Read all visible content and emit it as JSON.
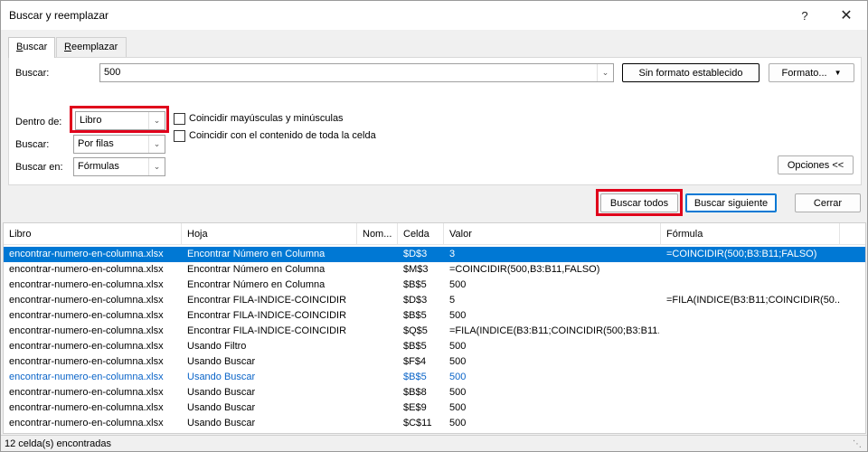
{
  "window": {
    "title": "Buscar y reemplazar",
    "help_label": "?",
    "close_label": "✕"
  },
  "tabs": {
    "find": {
      "prefix": "",
      "accel": "B",
      "rest": "uscar"
    },
    "replace": {
      "prefix": "",
      "accel": "R",
      "rest": "eemplazar"
    }
  },
  "search": {
    "label": "Buscar:",
    "value": "500",
    "no_format_label": "Sin formato establecido",
    "format_label": "Formato..."
  },
  "options": {
    "within_label": "Dentro de:",
    "within_value": "Libro",
    "search_label": "Buscar:",
    "search_value": "Por filas",
    "lookin_label": "Buscar en:",
    "lookin_value": "Fórmulas",
    "match_case_label": "Coincidir mayúsculas y minúsculas",
    "match_entire_label": "Coincidir con el contenido de toda la celda",
    "options_button": "Opciones <<"
  },
  "actions": {
    "find_all": "Buscar todos",
    "find_next": "Buscar siguiente",
    "close": "Cerrar"
  },
  "results": {
    "columns": [
      "Libro",
      "Hoja",
      "Nom...",
      "Celda",
      "Valor",
      "Fórmula"
    ],
    "rows": [
      [
        "encontrar-numero-en-columna.xlsx",
        "Encontrar Número en Columna",
        "",
        "$D$3",
        "3",
        "=COINCIDIR(500;B3:B11;FALSO)"
      ],
      [
        "encontrar-numero-en-columna.xlsx",
        "Encontrar Número en Columna",
        "",
        "$M$3",
        "=COINCIDIR(500,B3:B11,FALSO)",
        ""
      ],
      [
        "encontrar-numero-en-columna.xlsx",
        "Encontrar Número en Columna",
        "",
        "$B$5",
        "500",
        ""
      ],
      [
        "encontrar-numero-en-columna.xlsx",
        "Encontrar FILA-INDICE-COINCIDIR",
        "",
        "$D$3",
        "5",
        "=FILA(INDICE(B3:B11;COINCIDIR(50..."
      ],
      [
        "encontrar-numero-en-columna.xlsx",
        "Encontrar FILA-INDICE-COINCIDIR",
        "",
        "$B$5",
        "500",
        ""
      ],
      [
        "encontrar-numero-en-columna.xlsx",
        "Encontrar FILA-INDICE-COINCIDIR",
        "",
        "$Q$5",
        "=FILA(INDICE(B3:B11;COINCIDIR(500;B3:B11...",
        ""
      ],
      [
        "encontrar-numero-en-columna.xlsx",
        "Usando Filtro",
        "",
        "$B$5",
        "500",
        ""
      ],
      [
        "encontrar-numero-en-columna.xlsx",
        "Usando Buscar",
        "",
        "$F$4",
        "500",
        ""
      ],
      [
        "encontrar-numero-en-columna.xlsx",
        "Usando Buscar",
        "",
        "$B$5",
        "500",
        ""
      ],
      [
        "encontrar-numero-en-columna.xlsx",
        "Usando Buscar",
        "",
        "$B$8",
        "500",
        ""
      ],
      [
        "encontrar-numero-en-columna.xlsx",
        "Usando Buscar",
        "",
        "$E$9",
        "500",
        ""
      ],
      [
        "encontrar-numero-en-columna.xlsx",
        "Usando Buscar",
        "",
        "$C$11",
        "500",
        ""
      ]
    ]
  },
  "status": {
    "text": "12 celda(s) encontradas"
  },
  "colors": {
    "accent": "#0078d4",
    "highlight": "#e0001b",
    "link": "#0a64c8"
  }
}
